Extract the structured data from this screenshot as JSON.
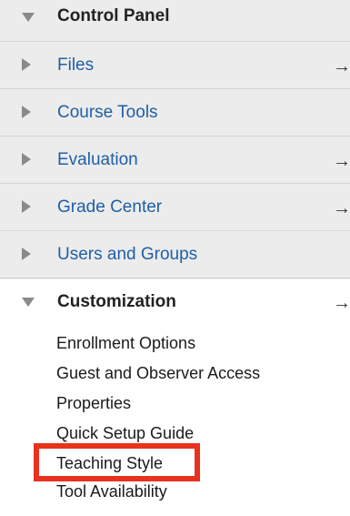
{
  "control_panel": {
    "title": "Control Panel",
    "items": [
      {
        "label": "Files",
        "has_arrow": true
      },
      {
        "label": "Course Tools",
        "has_arrow": false
      },
      {
        "label": "Evaluation",
        "has_arrow": true
      },
      {
        "label": "Grade Center",
        "has_arrow": true
      },
      {
        "label": "Users and Groups",
        "has_arrow": false
      }
    ]
  },
  "customization": {
    "title": "Customization",
    "items": [
      {
        "label": "Enrollment Options"
      },
      {
        "label": "Guest and Observer Access"
      },
      {
        "label": "Properties"
      },
      {
        "label": "Quick Setup Guide"
      },
      {
        "label": "Teaching Style"
      },
      {
        "label": "Tool Availability"
      }
    ]
  },
  "arrow_glyph": "→",
  "colors": {
    "panel_background": "#ececec",
    "link_blue": "#1f5fa6",
    "highlight_red": "#e8321e",
    "triangle_gray": "#8a8a8a"
  },
  "icons": {
    "expanded": "triangle-down-icon",
    "collapsed": "triangle-right-icon",
    "edit": "arrow-right-icon"
  }
}
